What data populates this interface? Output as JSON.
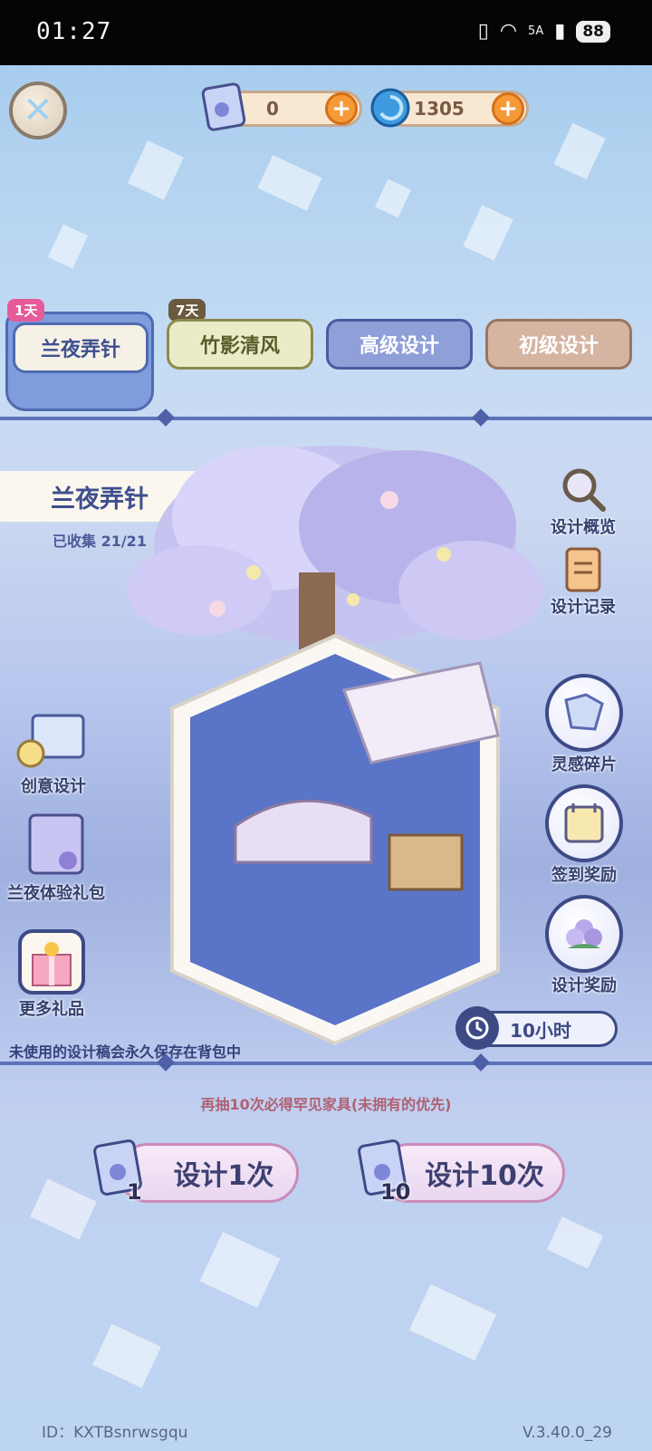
{
  "status_bar": {
    "time": "01:27",
    "network": "5A",
    "battery": "88"
  },
  "currency": {
    "tickets": {
      "value": "0",
      "icon": "design-scroll-icon"
    },
    "crystals": {
      "value": "1305",
      "icon": "swirl-gem-icon"
    }
  },
  "tabs": [
    {
      "label": "兰夜弄针",
      "badge": "1天",
      "active": true
    },
    {
      "label": "竹影清风",
      "badge": "7天",
      "active": false
    },
    {
      "label": "高级设计",
      "badge": "",
      "active": false
    },
    {
      "label": "初级设计",
      "badge": "",
      "active": false
    }
  ],
  "pool": {
    "name": "兰夜弄针",
    "collected": "已收集 21/21"
  },
  "right_menu": {
    "overview": "设计概览",
    "record": "设计记录",
    "fragments": "灵感碎片",
    "checkin": "签到奖励",
    "rewards": "设计奖励"
  },
  "left_menu": {
    "creative": "创意设计",
    "trial_pack": "兰夜体验礼包",
    "more_gifts": "更多礼品"
  },
  "timer": "10小时",
  "notes": {
    "save_hint": "未使用的设计稿会永久保存在背包中",
    "pity": "再抽10次必得罕见家具(未拥有的优先)"
  },
  "draw": {
    "single": {
      "label": "设计1次",
      "cost": "1"
    },
    "ten": {
      "label": "设计10次",
      "cost": "10"
    }
  },
  "footer": {
    "id": "ID：KXTBsnrwsgqu",
    "version": "V.3.40.0_29"
  },
  "colors": {
    "accent": "#4f6bb1",
    "orange": "#f59a36",
    "pink_text": "#b06072"
  }
}
